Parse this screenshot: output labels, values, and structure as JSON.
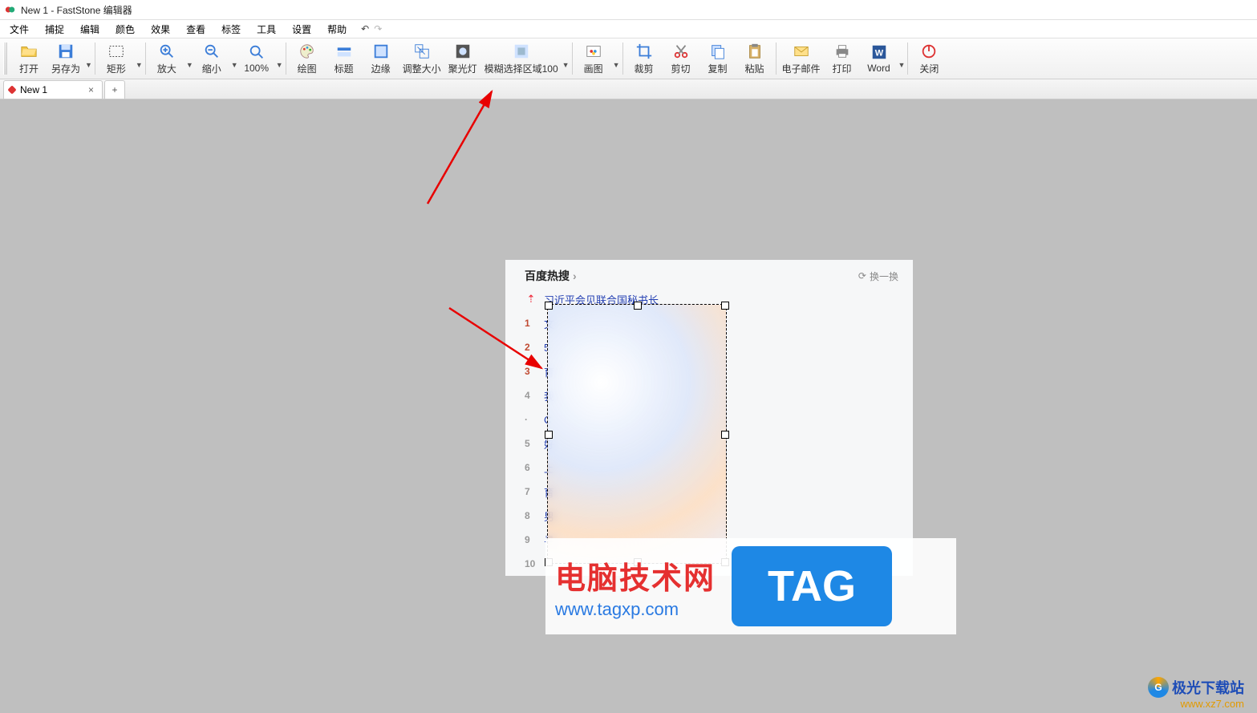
{
  "title": "New 1 - FastStone 编辑器",
  "menu": [
    "文件",
    "捕捉",
    "编辑",
    "颜色",
    "效果",
    "查看",
    "标签",
    "工具",
    "设置",
    "帮助"
  ],
  "undo_glyph": "↶",
  "redo_glyph": "↷",
  "toolbar": {
    "open": "打开",
    "saveas": "另存为",
    "rect": "矩形",
    "zoomin": "放大",
    "zoomout": "缩小",
    "zoom100": "100%",
    "draw": "绘图",
    "caption": "标题",
    "edge": "边缘",
    "resize": "调整大小",
    "spotlight": "聚光灯",
    "blur": "模糊选择区域100",
    "paint": "画图",
    "crop": "裁剪",
    "cut": "剪切",
    "copy": "复制",
    "paste": "粘贴",
    "email": "电子邮件",
    "print": "打印",
    "word": "Word",
    "close": "关闭"
  },
  "tab": {
    "name": "New 1",
    "close": "×",
    "add": "+"
  },
  "captured": {
    "title": "百度热搜",
    "refresh": "换一换",
    "top_label": "习近平会见联合国秘书长",
    "rows": [
      {
        "n": "1",
        "t": "文"
      },
      {
        "n": "2",
        "t": "5"
      },
      {
        "n": "3",
        "t": "育"
      },
      {
        "n": "4",
        "t": "我"
      },
      {
        "n": "·",
        "t": "C"
      },
      {
        "n": "5",
        "t": "好"
      },
      {
        "n": "6",
        "t": "上"
      },
      {
        "n": "7",
        "t": "育"
      },
      {
        "n": "8",
        "t": "男"
      },
      {
        "n": "9",
        "t": "寻"
      },
      {
        "n": "10",
        "t": ""
      }
    ]
  },
  "overlay": {
    "big": "电脑技术网",
    "url": "www.tagxp.com",
    "tag": "TAG"
  },
  "site": {
    "name": "极光下载站",
    "url": "www.xz7.com"
  }
}
